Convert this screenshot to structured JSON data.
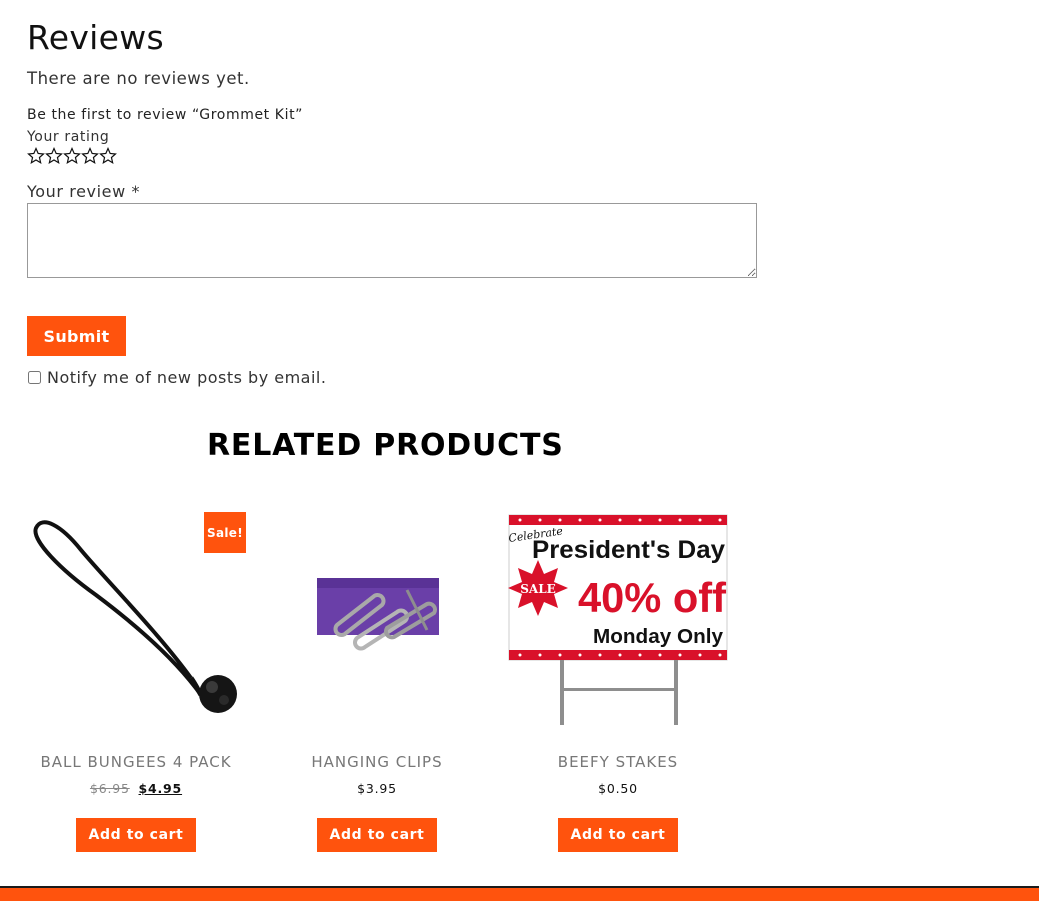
{
  "reviews": {
    "title": "Reviews",
    "no_reviews_text": "There are no reviews yet.",
    "first_review_text": "Be the first to review “Grommet Kit”",
    "rating_label": "Your rating",
    "stars_count": 5,
    "review_label": "Your review *",
    "review_value": "",
    "submit_label": "Submit",
    "notify_label": "Notify me of new posts by email.",
    "notify_checked": false
  },
  "related": {
    "heading": "RELATED PRODUCTS",
    "products": [
      {
        "title": "BALL BUNGEES 4 PACK",
        "price_old": "$6.95",
        "price_new": "$4.95",
        "badge": "Sale!",
        "button": "Add to cart",
        "image_icon": "ball-bungee-image"
      },
      {
        "title": "HANGING CLIPS",
        "price": "$3.95",
        "button": "Add to cart",
        "image_icon": "hanging-clips-image"
      },
      {
        "title": "BEEFY STAKES",
        "price": "$0.50",
        "button": "Add to cart",
        "image_icon": "presidents-day-sign-image",
        "sign": {
          "script_text": "Celebrate",
          "headline": "President's Day",
          "burst_text": "SALE",
          "discount": "40% off",
          "subline": "Monday Only"
        }
      }
    ]
  },
  "colors": {
    "accent": "#ff530d",
    "title_gray": "#777777",
    "sign_red": "#d9112a"
  }
}
